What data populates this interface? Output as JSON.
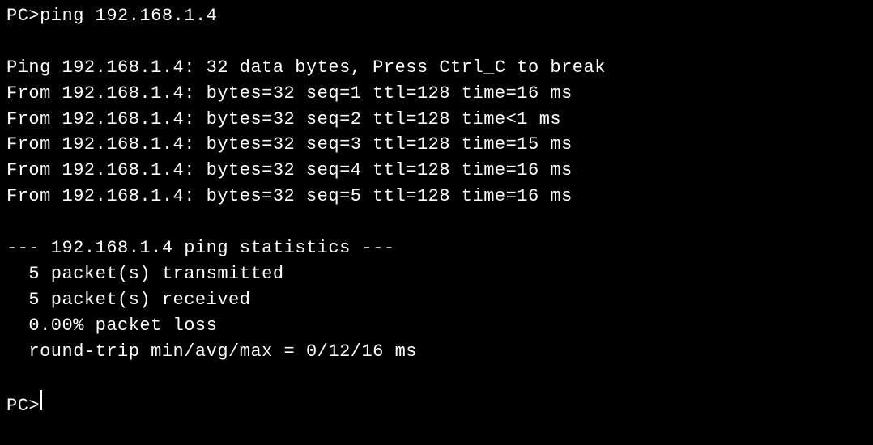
{
  "terminal": {
    "prompt": "PC>",
    "command": "ping 192.168.1.4",
    "header": "Ping 192.168.1.4: 32 data bytes, Press Ctrl_C to break",
    "replies": [
      "From 192.168.1.4: bytes=32 seq=1 ttl=128 time=16 ms",
      "From 192.168.1.4: bytes=32 seq=2 ttl=128 time<1 ms",
      "From 192.168.1.4: bytes=32 seq=3 ttl=128 time=15 ms",
      "From 192.168.1.4: bytes=32 seq=4 ttl=128 time=16 ms",
      "From 192.168.1.4: bytes=32 seq=5 ttl=128 time=16 ms"
    ],
    "stats": {
      "header": "--- 192.168.1.4 ping statistics ---",
      "transmitted": "  5 packet(s) transmitted",
      "received": "  5 packet(s) received",
      "loss": "  0.00% packet loss",
      "rtt": "  round-trip min/avg/max = 0/12/16 ms"
    },
    "final_prompt": "PC>"
  }
}
